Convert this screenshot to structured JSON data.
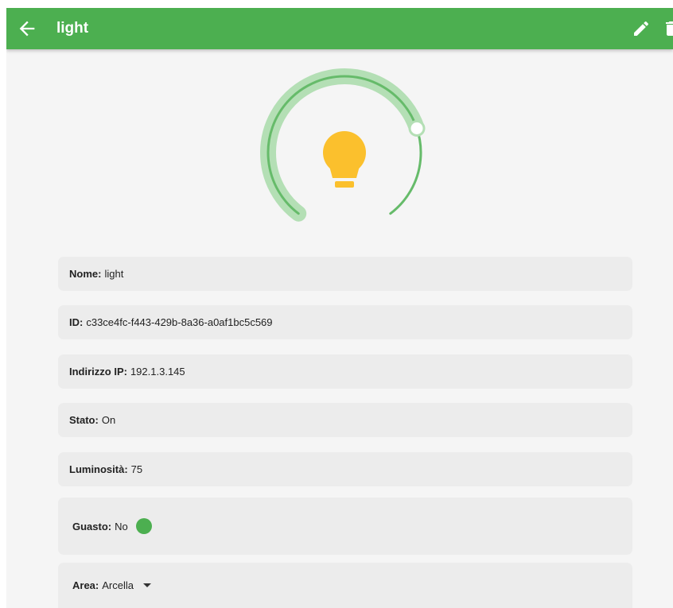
{
  "colors": {
    "appbar": "#4caf50",
    "gauge_track": "#b4dfb5",
    "gauge_line": "#66bb6a",
    "bulb": "#fbc02d",
    "status_dot": "#4caf50"
  },
  "appbar": {
    "title": "light",
    "back_icon": "arrow-left-icon",
    "edit_icon": "pencil-icon",
    "delete_icon": "trash-icon"
  },
  "gauge": {
    "brightness": 75,
    "state": "On",
    "icon": "lightbulb-icon"
  },
  "fields": {
    "name": {
      "label": "Nome:",
      "value": "light"
    },
    "id": {
      "label": "ID:",
      "value": "c33ce4fc-f443-429b-8a36-a0af1bc5c569"
    },
    "ip": {
      "label": "Indirizzo IP:",
      "value": "192.1.3.145"
    },
    "state": {
      "label": "Stato:",
      "value": "On"
    },
    "brightness": {
      "label": "Luminosità:",
      "value": "75"
    },
    "fault": {
      "label": "Guasto:",
      "value": "No"
    },
    "area": {
      "label": "Area:",
      "value": "Arcella"
    }
  }
}
